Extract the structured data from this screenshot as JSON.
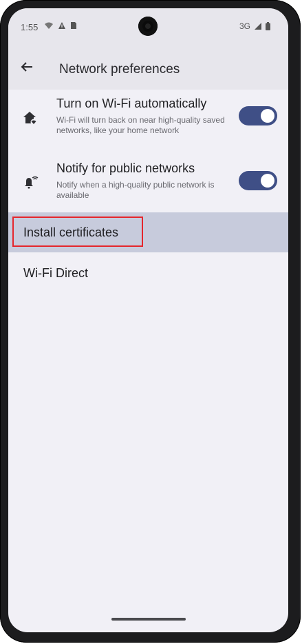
{
  "status": {
    "time": "1:55",
    "network": "3G"
  },
  "appbar": {
    "title": "Network preferences"
  },
  "settings": [
    {
      "title": "Turn on Wi-Fi automatically",
      "subtitle": "Wi-Fi will turn back on near high-quality saved networks, like your home network",
      "icon": "wifi-home-icon",
      "toggle_on": true
    },
    {
      "title": "Notify for public networks",
      "subtitle": "Notify when a high-quality public network is available",
      "icon": "notification-wifi-icon",
      "toggle_on": true
    }
  ],
  "list": {
    "install_certificates": "Install certificates",
    "wifi_direct": "Wi-Fi Direct"
  },
  "colors": {
    "accent": "#3f4f86",
    "highlight": "#c7cbdc",
    "annotation_border": "#e5262c"
  }
}
